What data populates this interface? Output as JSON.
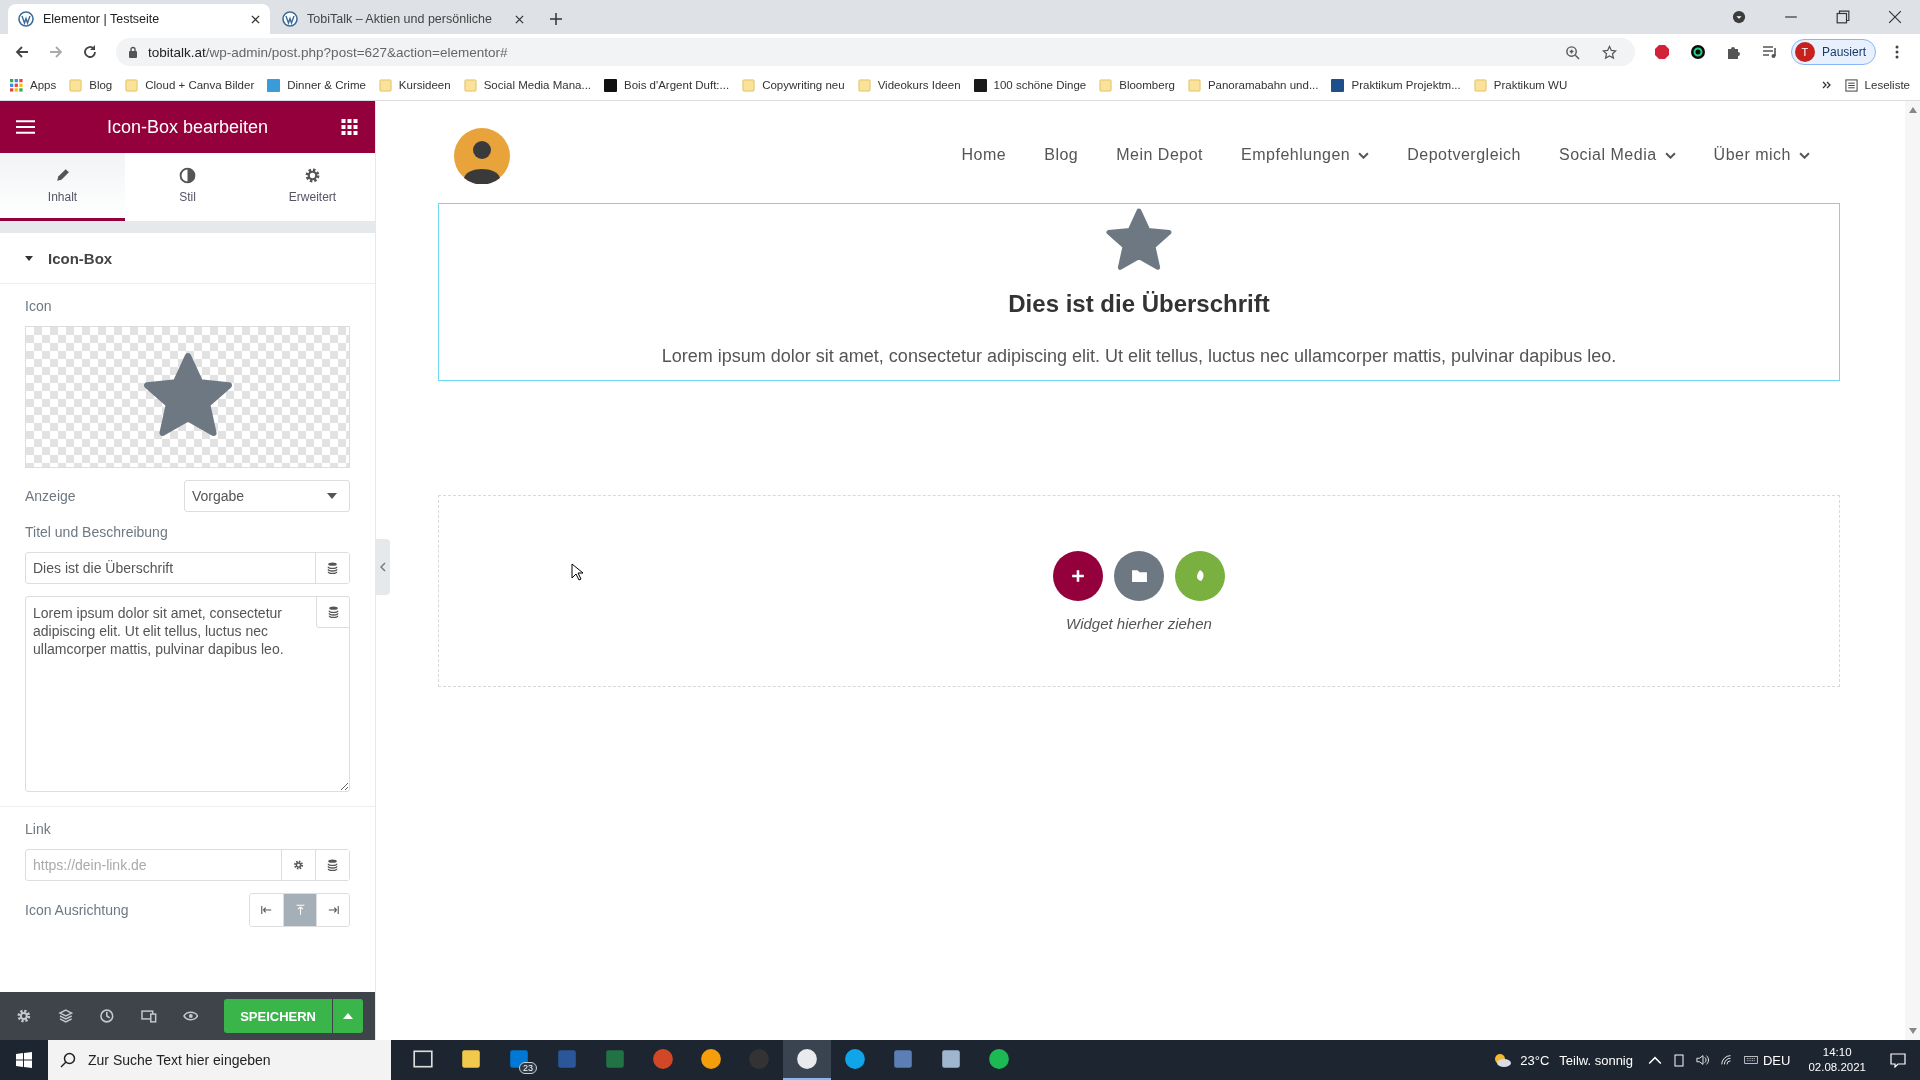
{
  "browser": {
    "tabs": [
      {
        "title": "Elementor | Testseite",
        "selected": true
      },
      {
        "title": "TobiTalk – Aktien und persönliche",
        "selected": false
      }
    ],
    "url": {
      "host": "tobitalk.at",
      "path": "/wp-admin/post.php?post=627&action=elementor#"
    },
    "profile": {
      "initial": "T",
      "label": "Pausiert"
    },
    "bookmarks": [
      {
        "label": "Apps",
        "kind": "apps"
      },
      {
        "label": "Blog",
        "kind": "folder"
      },
      {
        "label": "Cloud + Canva Bilder",
        "kind": "folder"
      },
      {
        "label": "Dinner & Crime",
        "kind": "site",
        "color": "#3a9bd9"
      },
      {
        "label": "Kursideen",
        "kind": "folder"
      },
      {
        "label": "Social Media Mana...",
        "kind": "folder"
      },
      {
        "label": "Bois d'Argent Duft:...",
        "kind": "site",
        "color": "#111111"
      },
      {
        "label": "Copywriting neu",
        "kind": "folder"
      },
      {
        "label": "Videokurs Ideen",
        "kind": "folder"
      },
      {
        "label": "100 schöne Dinge",
        "kind": "site",
        "color": "#1a1a1a"
      },
      {
        "label": "Bloomberg",
        "kind": "folder"
      },
      {
        "label": "Panoramabahn und...",
        "kind": "folder"
      },
      {
        "label": "Praktikum Projektm...",
        "kind": "site",
        "color": "#1f4e8c"
      },
      {
        "label": "Praktikum WU",
        "kind": "folder"
      }
    ],
    "reading_list": "Leseliste"
  },
  "editor": {
    "title": "Icon-Box bearbeiten",
    "tabs": [
      {
        "label": "Inhalt",
        "selected": true
      },
      {
        "label": "Stil",
        "selected": false
      },
      {
        "label": "Erweitert",
        "selected": false
      }
    ],
    "section": {
      "title": "Icon-Box",
      "expanded": true
    },
    "icon_label": "Icon",
    "display": {
      "label": "Anzeige",
      "value": "Vorgabe"
    },
    "title_desc_label": "Titel und Beschreibung",
    "title_value": "Dies ist die Überschrift",
    "description_value": "Lorem ipsum dolor sit amet, consectetur adipiscing elit. Ut elit tellus, luctus nec ullamcorper mattis, pulvinar dapibus leo.",
    "link": {
      "label": "Link",
      "placeholder": "https://dein-link.de"
    },
    "alignment": {
      "label": "Icon Ausrichtung",
      "options": [
        {
          "selected": false
        },
        {
          "selected": true
        },
        {
          "selected": false
        }
      ]
    },
    "save": "SPEICHERN"
  },
  "canvas": {
    "nav": [
      {
        "label": "Home",
        "dropdown": false
      },
      {
        "label": "Blog",
        "dropdown": false
      },
      {
        "label": "Mein Depot",
        "dropdown": false
      },
      {
        "label": "Empfehlungen",
        "dropdown": true
      },
      {
        "label": "Depotvergleich",
        "dropdown": false
      },
      {
        "label": "Social Media",
        "dropdown": true
      },
      {
        "label": "Über mich",
        "dropdown": true
      }
    ],
    "icon_box": {
      "heading": "Dies ist die Überschrift",
      "text": "Lorem ipsum dolor sit amet, consectetur adipiscing elit. Ut elit tellus, luctus nec ullamcorper mattis, pulvinar dapibus leo."
    },
    "dropzone": {
      "hint": "Widget hierher ziehen"
    }
  },
  "taskbar": {
    "search_placeholder": "Zur Suche Text hier eingeben",
    "apps": [
      {
        "selected": false
      },
      {
        "selected": false
      },
      {
        "selected": false,
        "badge": "23"
      },
      {
        "selected": false
      },
      {
        "selected": false
      },
      {
        "selected": false
      },
      {
        "selected": false
      },
      {
        "selected": false
      },
      {
        "selected": true
      },
      {
        "selected": false
      },
      {
        "selected": false
      },
      {
        "selected": false
      },
      {
        "selected": false
      }
    ],
    "weather": {
      "temp": "23°C",
      "text": "Teilw. sonnig"
    },
    "language": "DEU",
    "time": "14:10",
    "date": "02.08.2021"
  }
}
